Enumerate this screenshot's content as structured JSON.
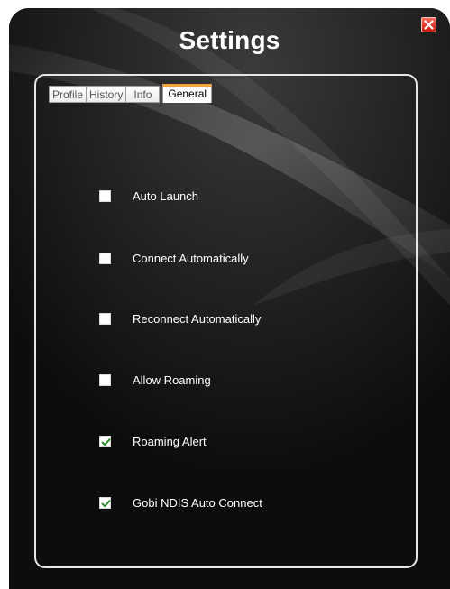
{
  "window": {
    "title": "Settings"
  },
  "tabs": [
    {
      "label": "Profile",
      "active": false
    },
    {
      "label": "History",
      "active": false
    },
    {
      "label": "Info",
      "active": false
    },
    {
      "label": "General",
      "active": true
    }
  ],
  "options": [
    {
      "label": "Auto Launch",
      "checked": false
    },
    {
      "label": "Connect Automatically",
      "checked": false
    },
    {
      "label": "Reconnect Automatically",
      "checked": false
    },
    {
      "label": "Allow Roaming",
      "checked": false
    },
    {
      "label": "Roaming Alert",
      "checked": true
    },
    {
      "label": "Gobi NDIS Auto Connect",
      "checked": true
    }
  ],
  "colors": {
    "window_bg": "#0d0d0d",
    "active_tab_accent": "#f0a33a",
    "check_mark": "#2e8b2e",
    "close_button": "#d9301f"
  },
  "icons": {
    "close": "close-icon",
    "check": "check-icon"
  }
}
